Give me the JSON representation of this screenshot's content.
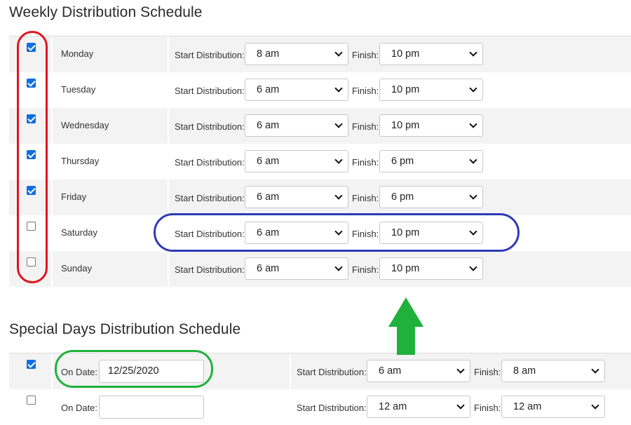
{
  "weekly": {
    "title": "Weekly Distribution Schedule",
    "start_label": "Start Distribution:",
    "finish_label": "Finish:",
    "rows": [
      {
        "checked": true,
        "day": "Monday",
        "start": "8 am",
        "finish": "10 pm"
      },
      {
        "checked": true,
        "day": "Tuesday",
        "start": "6 am",
        "finish": "10 pm"
      },
      {
        "checked": true,
        "day": "Wednesday",
        "start": "6 am",
        "finish": "10 pm"
      },
      {
        "checked": true,
        "day": "Thursday",
        "start": "6 am",
        "finish": "6 pm"
      },
      {
        "checked": true,
        "day": "Friday",
        "start": "6 am",
        "finish": "6 pm"
      },
      {
        "checked": false,
        "day": "Saturday",
        "start": "6 am",
        "finish": "10 pm"
      },
      {
        "checked": false,
        "day": "Sunday",
        "start": "6 am",
        "finish": "10 pm"
      }
    ]
  },
  "special": {
    "title": "Special Days Distribution Schedule",
    "date_label": "On Date:",
    "start_label": "Start Distribution:",
    "finish_label": "Finish:",
    "rows": [
      {
        "checked": true,
        "date": "12/25/2020",
        "start": "6 am",
        "finish": "8 am"
      },
      {
        "checked": false,
        "date": "",
        "start": "12 am",
        "finish": "12 am"
      }
    ]
  },
  "annotations": {
    "checkbox_ring_color": "#e0151f",
    "saturday_ring_color": "#2f39b8",
    "date_ring_color": "#20b13c",
    "arrow_color": "#20b13c"
  },
  "colors": {
    "checkbox_checked": "#0f6fe0",
    "row_shade": "#f3f3f3",
    "border": "#c7c7c7"
  }
}
